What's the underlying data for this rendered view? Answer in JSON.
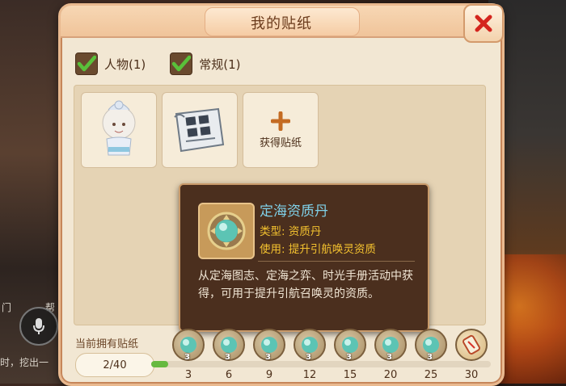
{
  "window": {
    "title": "我的贴纸"
  },
  "filters": [
    {
      "label": "人物(1)",
      "checked": true
    },
    {
      "label": "常规(1)",
      "checked": true
    }
  ],
  "grid": {
    "slots": [
      {
        "type": "sticker",
        "icon": "character-sticker-icon"
      },
      {
        "type": "sticker",
        "icon": "newspaper-sticker-icon"
      },
      {
        "type": "get",
        "label": "获得贴纸",
        "icon": "plus-icon"
      }
    ]
  },
  "tooltip": {
    "name": "定海资质丹",
    "type_line": "类型: 资质丹",
    "use_line": "使用: 提升引航唤灵资质",
    "description": "从定海图志、定海之弈、时光手册活动中获得，可用于提升引航召唤灵的资质。",
    "icon": "pearl-orb-icon"
  },
  "progress": {
    "label": "当前拥有贴纸",
    "count_text": "2/40",
    "owned": 2,
    "total": 40,
    "milestones": [
      {
        "value": "3",
        "reward_count": "3",
        "icon": "pearl-orb-icon"
      },
      {
        "value": "6",
        "reward_count": "3",
        "icon": "pearl-orb-icon"
      },
      {
        "value": "9",
        "reward_count": "3",
        "icon": "pearl-orb-icon"
      },
      {
        "value": "12",
        "reward_count": "3",
        "icon": "pearl-orb-icon"
      },
      {
        "value": "15",
        "reward_count": "3",
        "icon": "pearl-orb-icon"
      },
      {
        "value": "20",
        "reward_count": "3",
        "icon": "pearl-orb-icon"
      },
      {
        "value": "25",
        "reward_count": "3",
        "icon": "pearl-orb-icon"
      },
      {
        "value": "30",
        "reward_count": "",
        "icon": "scroll-reward-icon"
      }
    ]
  },
  "background": {
    "left_text_1": "门",
    "left_text_2": "帮",
    "left_text_3": "时，挖出一"
  },
  "colors": {
    "check_green": "#59c13a",
    "close_red": "#d4251e",
    "tooltip_name": "#7fd0e8",
    "tooltip_meta": "#f3c12f",
    "progress_fill": "#66b93f"
  }
}
